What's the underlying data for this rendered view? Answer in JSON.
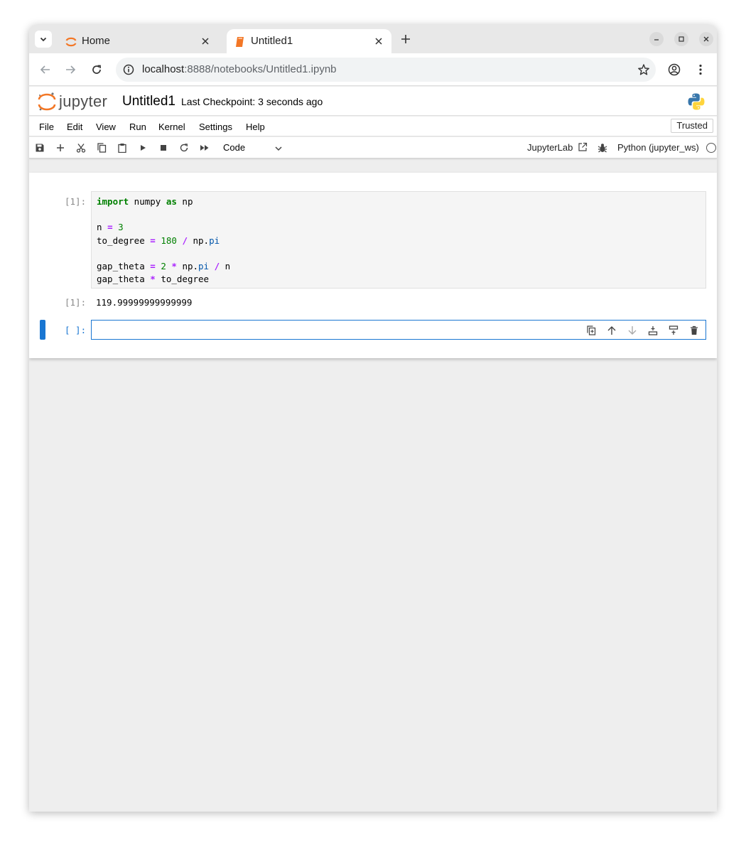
{
  "browser": {
    "tabs": [
      {
        "title": "Home",
        "active": false
      },
      {
        "title": "Untitled1",
        "active": true
      }
    ],
    "url_host": "localhost",
    "url_rest": ":8888/notebooks/Untitled1.ipynb"
  },
  "jupyter": {
    "logo_text": "jupyter",
    "notebook_title": "Untitled1",
    "checkpoint": "Last Checkpoint: 3 seconds ago",
    "menu": [
      "File",
      "Edit",
      "View",
      "Run",
      "Kernel",
      "Settings",
      "Help"
    ],
    "trusted": "Trusted",
    "cell_type": "Code",
    "jupyterlab_link": "JupyterLab",
    "kernel": "Python (jupyter_ws)"
  },
  "cells": {
    "cell1": {
      "input_prompt": "[1]:",
      "output_prompt": "[1]:",
      "output": "119.99999999999999"
    },
    "cell2": {
      "input_prompt": "[ ]:"
    }
  },
  "colors": {
    "accent": "#1976d2",
    "jupyter_orange": "#f37726",
    "keyword_green": "#008000",
    "operator_purple": "#aa22ff"
  }
}
